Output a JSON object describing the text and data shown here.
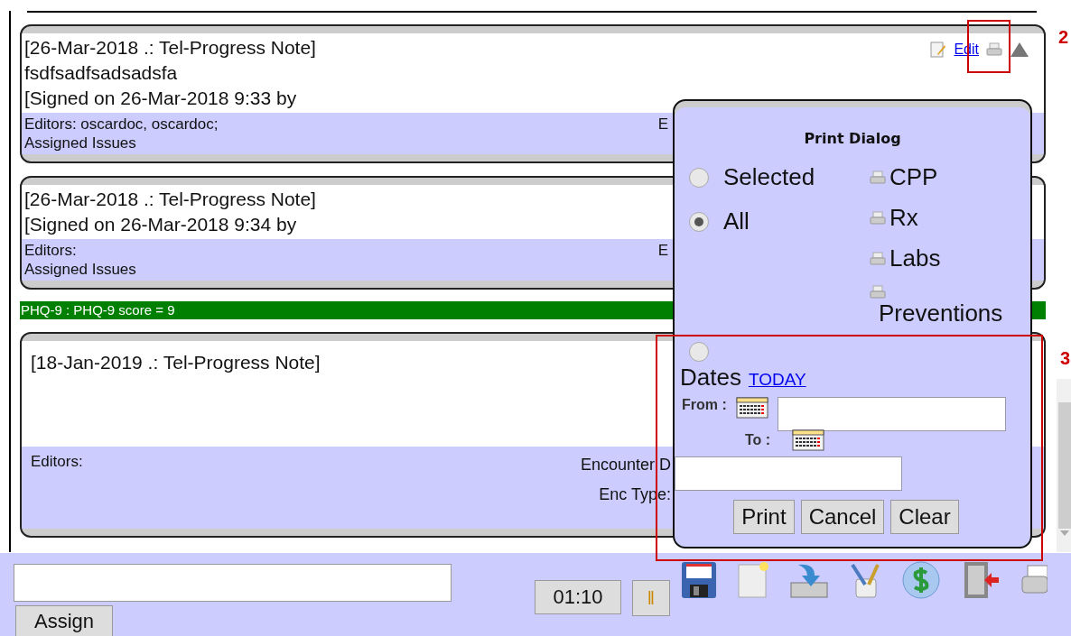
{
  "notes": [
    {
      "header": "[26-Mar-2018 .: Tel-Progress Note]",
      "body": "fsdfsadfsadsadsfa",
      "signed": "[Signed on 26-Mar-2018 9:33 by",
      "editors": "Editors: oscardoc, oscardoc;",
      "issues": "Assigned Issues",
      "fragment": "E",
      "edit_link": "Edit"
    },
    {
      "header": "[26-Mar-2018 .: Tel-Progress Note]",
      "signed": "[Signed on 26-Mar-2018 9:34 by",
      "editors": "Editors:",
      "issues": "Assigned Issues",
      "fragment": "E"
    }
  ],
  "measurement_bar": {
    "text": "PHQ-9 : PHQ-9 score = 9"
  },
  "open_note": {
    "header": "[18-Jan-2019 .: Tel-Progress Note]",
    "editors": "Editors:",
    "encounter_date_label": "Encounter D",
    "enc_type_label": "Enc Type:"
  },
  "print_dialog": {
    "title": "Print Dialog",
    "scopes": [
      {
        "label": "Selected",
        "selected": false
      },
      {
        "label": "All",
        "selected": true
      }
    ],
    "sections": [
      "CPP",
      "Rx",
      "Labs",
      "Preventions"
    ],
    "dates_option": {
      "label": "Dates",
      "selected": false
    },
    "today_link": "TODAY",
    "from_label": "From :",
    "to_label": "To :",
    "buttons": [
      "Print",
      "Cancel",
      "Clear"
    ]
  },
  "bottom_bar": {
    "assign": "Assign",
    "timer": "01:10",
    "pause": "‖"
  },
  "annotations": [
    {
      "label": "2"
    },
    {
      "label": "3"
    }
  ]
}
